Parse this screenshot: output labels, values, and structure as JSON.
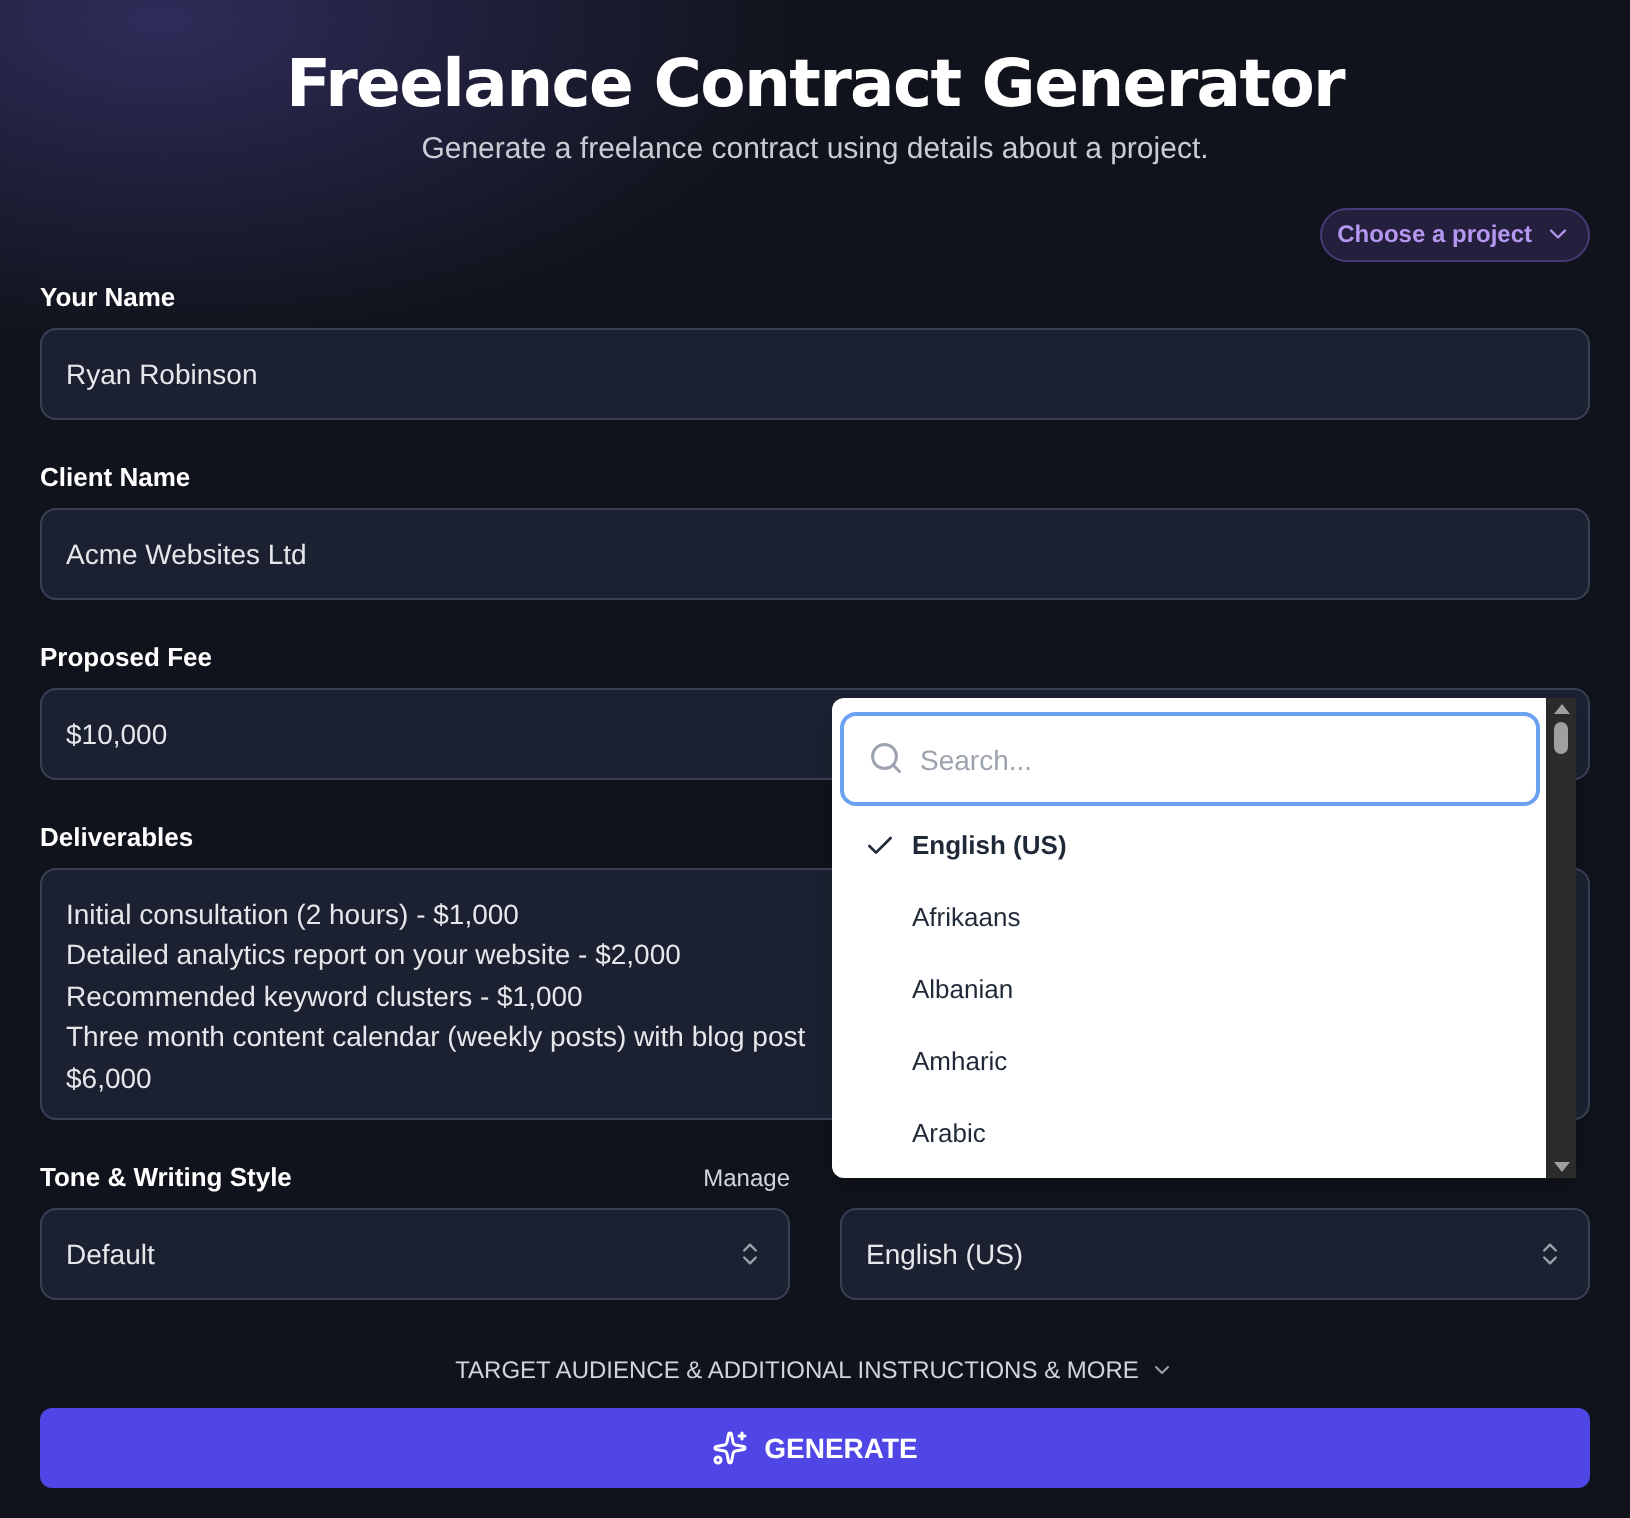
{
  "header": {
    "title": "Freelance Contract Generator",
    "subtitle": "Generate a freelance contract using details about a project.",
    "project_button": "Choose a project"
  },
  "fields": [
    {
      "label": "Your Name",
      "value": "Ryan Robinson"
    },
    {
      "label": "Client Name",
      "value": "Acme Websites Ltd"
    },
    {
      "label": "Proposed Fee",
      "value": "$10,000"
    }
  ],
  "deliverables": {
    "label": "Deliverables",
    "lines": [
      "Initial consultation (2 hours) - $1,000",
      "Detailed analytics report on your website - $2,000",
      "Recommended keyword clusters - $1,000",
      "Three month content calendar (weekly posts) with blog post",
      "$6,000"
    ]
  },
  "tone": {
    "label": "Tone & Writing Style",
    "manage": "Manage",
    "value": "Default"
  },
  "language": {
    "value": "English (US)",
    "search": {
      "placeholder": "Search..."
    },
    "options": [
      {
        "label": "English (US)",
        "selected": true
      },
      {
        "label": "Afrikaans",
        "selected": false
      },
      {
        "label": "Albanian",
        "selected": false
      },
      {
        "label": "Amharic",
        "selected": false
      },
      {
        "label": "Arabic",
        "selected": false
      }
    ]
  },
  "more_toggle": "TARGET AUDIENCE & ADDITIONAL INSTRUCTIONS & MORE",
  "generate_button": "GENERATE"
}
